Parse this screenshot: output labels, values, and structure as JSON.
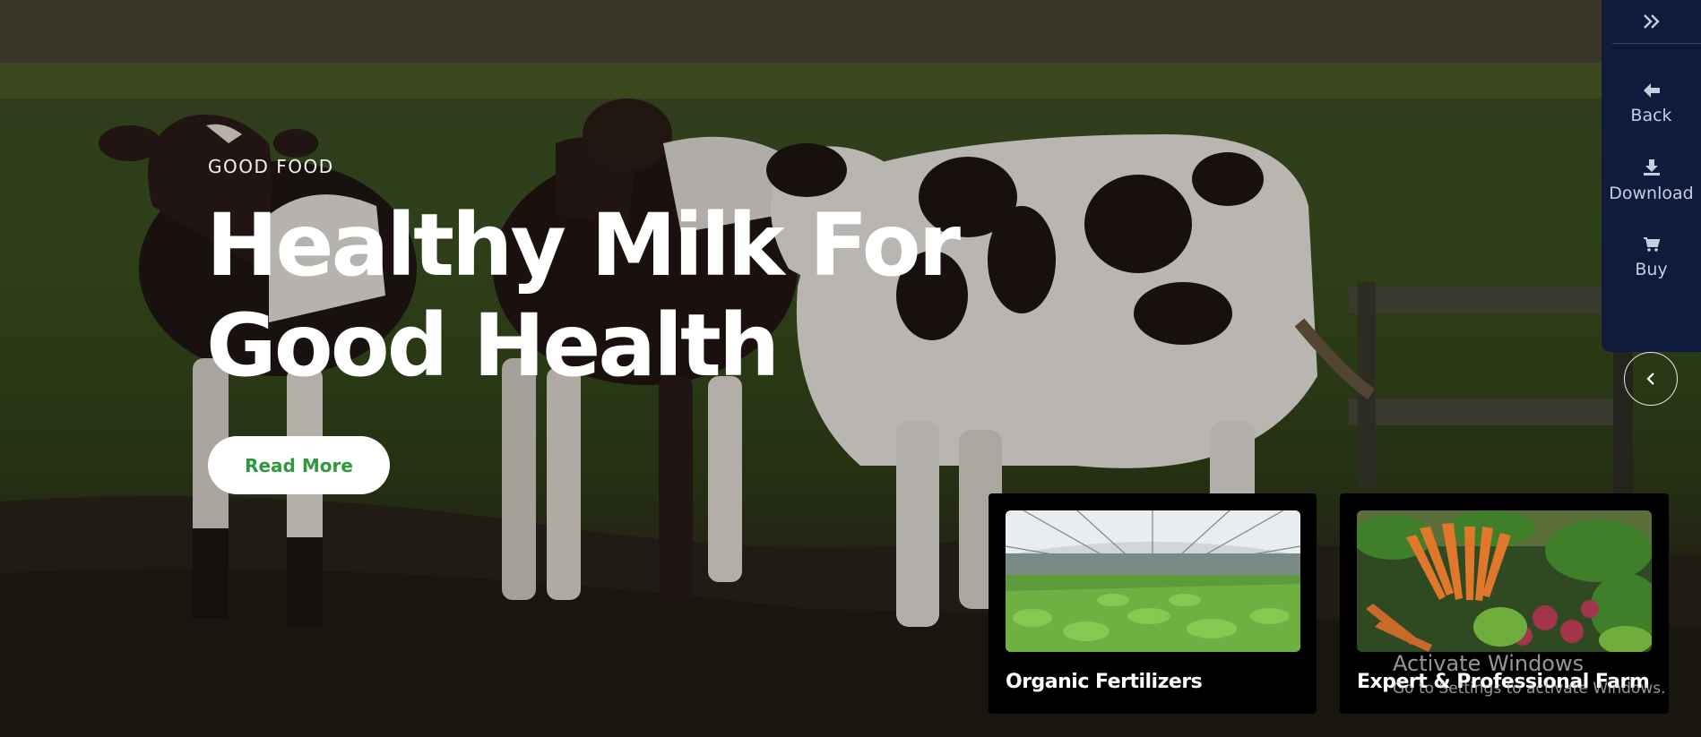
{
  "hero": {
    "kicker": "GOOD FOOD",
    "headline_line1": "Healthy Milk For",
    "headline_line2": "Good Health",
    "cta_label": "Read More"
  },
  "side_panel": {
    "toggle_icon": "double-chevron-right-icon",
    "items": [
      {
        "label": "Back",
        "icon": "arrow-left-icon"
      },
      {
        "label": "Download",
        "icon": "download-icon"
      },
      {
        "label": "Buy",
        "icon": "cart-icon"
      }
    ]
  },
  "slider_prev_icon": "chevron-left-icon",
  "cards": [
    {
      "title": "Organic Fertilizers",
      "image": "greenhouse-image"
    },
    {
      "title": "Expert & Professional Farm",
      "image": "vegetables-image"
    }
  ],
  "watermark": {
    "title": "Activate Windows",
    "subtitle": "Go to Settings to activate Windows."
  },
  "colors": {
    "panel_bg": "#0f1a3d",
    "cta_text": "#2e9a3c",
    "card_bg": "#000000"
  }
}
